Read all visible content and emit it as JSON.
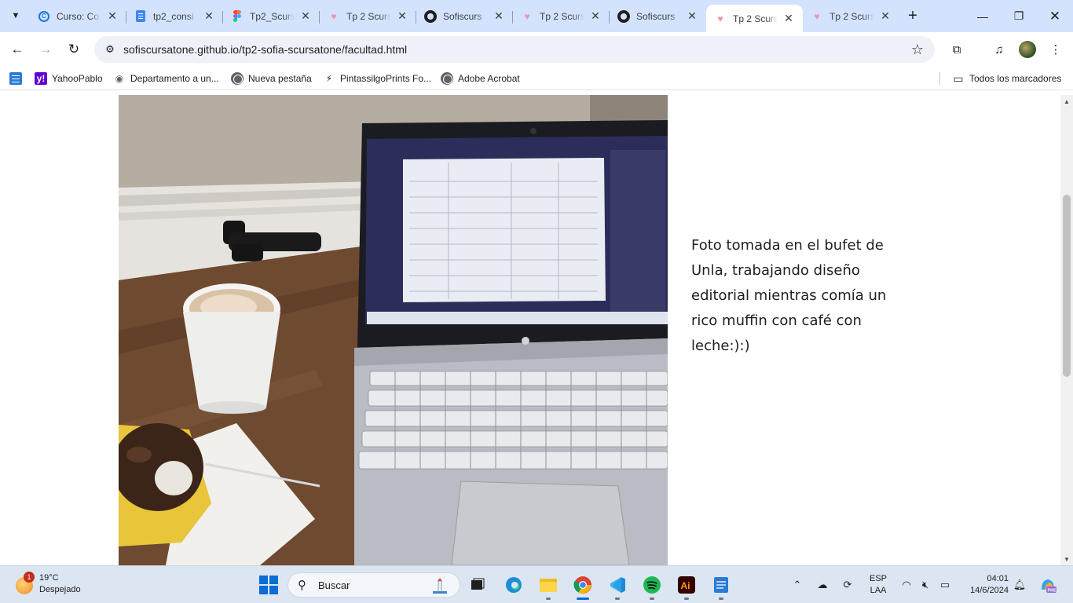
{
  "browser": {
    "tabs": [
      {
        "title": "Curso: Co",
        "favicon": "curso-icon"
      },
      {
        "title": "tp2_consi",
        "favicon": "docs-icon"
      },
      {
        "title": "Tp2_Scurs",
        "favicon": "figma-icon"
      },
      {
        "title": "Tp 2 Scurs",
        "favicon": "heart-icon"
      },
      {
        "title": "Sofiscurs",
        "favicon": "github-icon"
      },
      {
        "title": "Tp 2 Scurs",
        "favicon": "heart-icon"
      },
      {
        "title": "Sofiscurs",
        "favicon": "github-icon"
      },
      {
        "title": "Tp 2 Scurs",
        "favicon": "heart-icon",
        "active": true
      },
      {
        "title": "Tp 2 Scurs",
        "favicon": "heart-icon"
      }
    ],
    "url": "sofiscursatone.github.io/tp2-sofia-scursatone/facultad.html",
    "bookmarks": [
      {
        "label": "YahooPablo",
        "icon": "yahoo-icon"
      },
      {
        "label": "Departamento a un...",
        "icon": "eye-icon"
      },
      {
        "label": "Nueva pestaña",
        "icon": "globe-icon"
      },
      {
        "label": "PintassilgoPrints Fo...",
        "icon": "bolt-icon"
      },
      {
        "label": "Adobe Acrobat",
        "icon": "globe-icon"
      }
    ],
    "all_bookmarks": "Todos los marcadores"
  },
  "page": {
    "caption": "Foto tomada en el bufet de Unla, trabajando diseño editorial mientras comía un rico muffin con café con leche:):)",
    "scroll_position": 0.33
  },
  "taskbar": {
    "weather_temp": "19°C",
    "weather_condition": "Despejado",
    "weather_badge": "1",
    "search_placeholder": "Buscar",
    "language_line1": "ESP",
    "language_line2": "LAA",
    "time": "04:01",
    "date": "14/6/2024"
  },
  "colors": {
    "tabstrip": "#d3e3fd",
    "taskbar": "#dbe6f2",
    "accent": "#0a6cd4"
  }
}
